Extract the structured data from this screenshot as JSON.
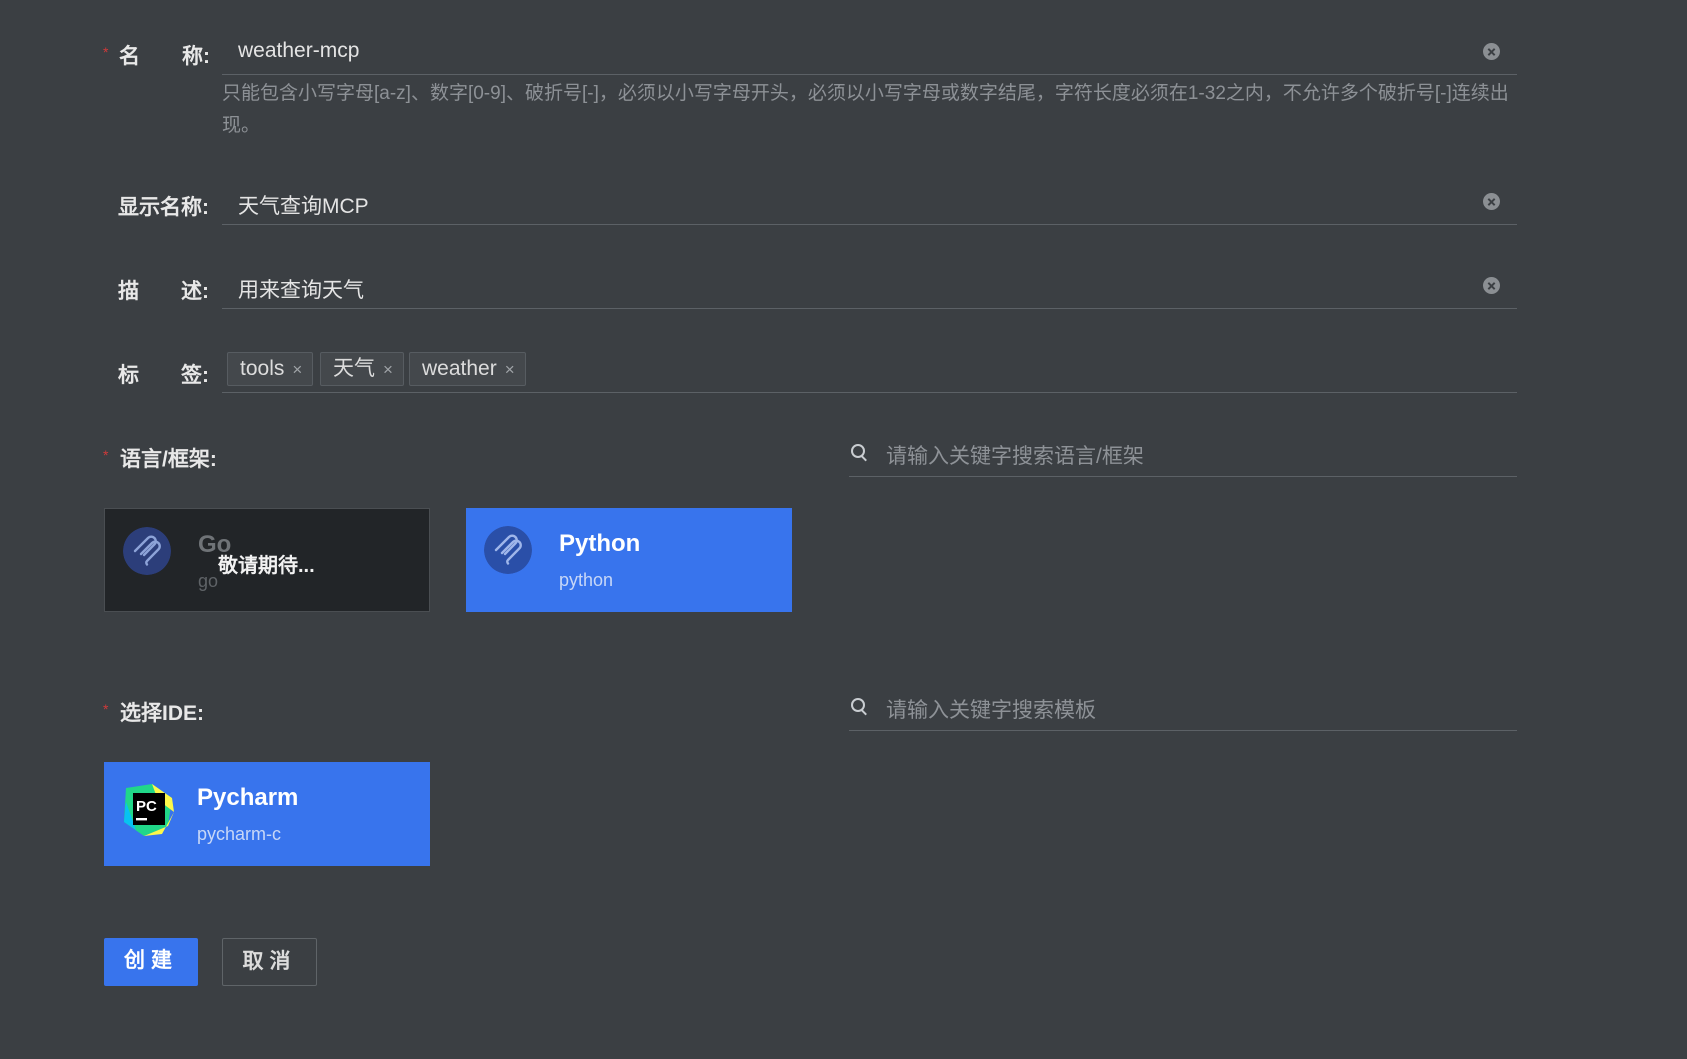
{
  "form": {
    "name": {
      "label": "名　　称:",
      "value": "weather-mcp",
      "hint": "只能包含小写字母[a-z]、数字[0-9]、破折号[-]，必须以小写字母开头，必须以小写字母或数字结尾，字符长度必须在1-32之内，不允许多个破折号[-]连续出现。"
    },
    "display_name": {
      "label": "显示名称:",
      "value": "天气查询MCP"
    },
    "description": {
      "label": "描　　述:",
      "value": "用来查询天气"
    },
    "tags": {
      "label": "标　　签:",
      "items": [
        "tools",
        "天气",
        "weather"
      ],
      "remove_glyph": "×"
    },
    "language": {
      "label": "语言/框架:",
      "search_placeholder": "请输入关键字搜索语言/框架",
      "options": [
        {
          "title": "Go",
          "subtitle": "go",
          "overlay": "敬请期待...",
          "state": "disabled"
        },
        {
          "title": "Python",
          "subtitle": "python",
          "state": "selected"
        }
      ]
    },
    "ide": {
      "label": "选择IDE:",
      "search_placeholder": "请输入关键字搜索模板",
      "options": [
        {
          "title": "Pycharm",
          "subtitle": "pycharm-c",
          "icon_text": "PC",
          "state": "selected"
        }
      ]
    },
    "required_mark": "*",
    "buttons": {
      "create": "创建",
      "cancel": "取消"
    }
  },
  "colors": {
    "background": "#3b3f43",
    "accent": "#3874ed",
    "disabled_card": "#222528",
    "required": "#d03a3a"
  }
}
